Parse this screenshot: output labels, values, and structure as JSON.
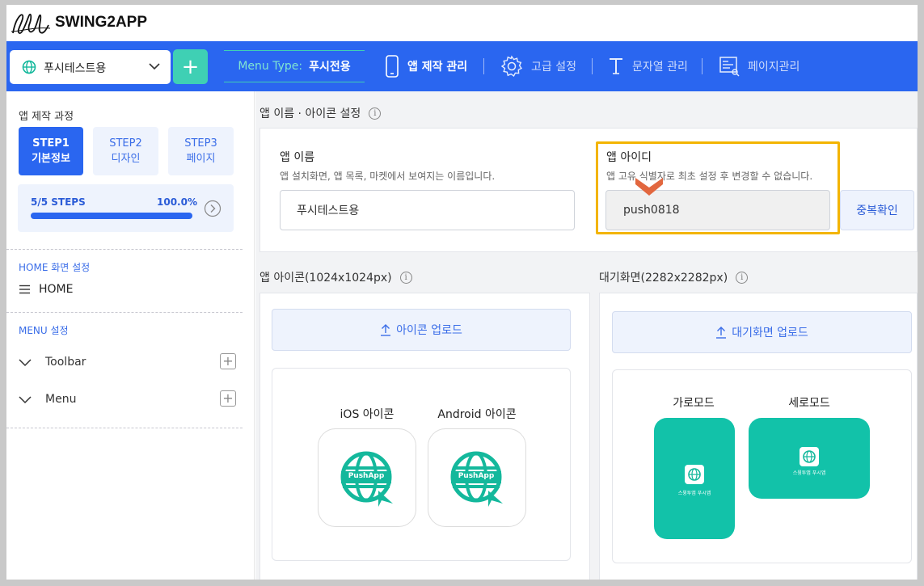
{
  "brand": {
    "name": "SWING2APP"
  },
  "topnav": {
    "app_name": "푸시테스트용",
    "menu_type_label": "Menu Type:",
    "menu_type_value": "푸시전용",
    "items": [
      {
        "label": "앱 제작 관리",
        "icon": "phone-icon"
      },
      {
        "label": "고급 설정",
        "icon": "gear-icon"
      },
      {
        "label": "문자열 관리",
        "icon": "text-icon"
      },
      {
        "label": "페이지관리",
        "icon": "page-icon"
      }
    ],
    "plus_symbol": "+"
  },
  "sidebar": {
    "title": "앱 제작 과정",
    "steps": [
      {
        "line1": "STEP1",
        "line2": "기본정보"
      },
      {
        "line1": "STEP2",
        "line2": "디자인"
      },
      {
        "line1": "STEP3",
        "line2": "페이지"
      }
    ],
    "progress": {
      "label": "5/5 STEPS",
      "percent_text": "100.0%",
      "fraction": 1.0
    },
    "home_section": "HOME 화면 설정",
    "home_item": "HOME",
    "menu_section": "MENU 설정",
    "menu_items": [
      {
        "label": "Toolbar"
      },
      {
        "label": "Menu"
      }
    ]
  },
  "main": {
    "name_section_title": "앱 이름 · 아이콘 설정",
    "app_name_label": "앱 이름",
    "app_name_desc": "앱 설치화면, 앱 목록, 마켓에서 보여지는 이름입니다.",
    "app_name_value": "푸시테스트용",
    "app_id_label": "앱 아이디",
    "app_id_desc": "앱 고유 식별자로 최초 설정 후 변경할 수 없습니다.",
    "app_id_value": "push0818",
    "dup_check": "중복확인",
    "icon_section_title": "앱 아이콘(1024x1024px)",
    "splash_section_title": "대기화면(2282x2282px)",
    "icon_upload": "아이콘 업로드",
    "splash_upload": "대기화면 업로드",
    "ios_label": "iOS 아이콘",
    "android_label": "Android 아이콘",
    "icon_text": "PushApp",
    "landscape_label": "가로모드",
    "portrait_label": "세로모드",
    "splash_caption": "스윙투앱 푸시앱",
    "info_symbol": "i"
  },
  "colors": {
    "primary": "#2a66f0",
    "teal": "#3fd0b4",
    "splash": "#12c2a9",
    "highlight": "#f3b400",
    "arrow": "#e2673f"
  }
}
